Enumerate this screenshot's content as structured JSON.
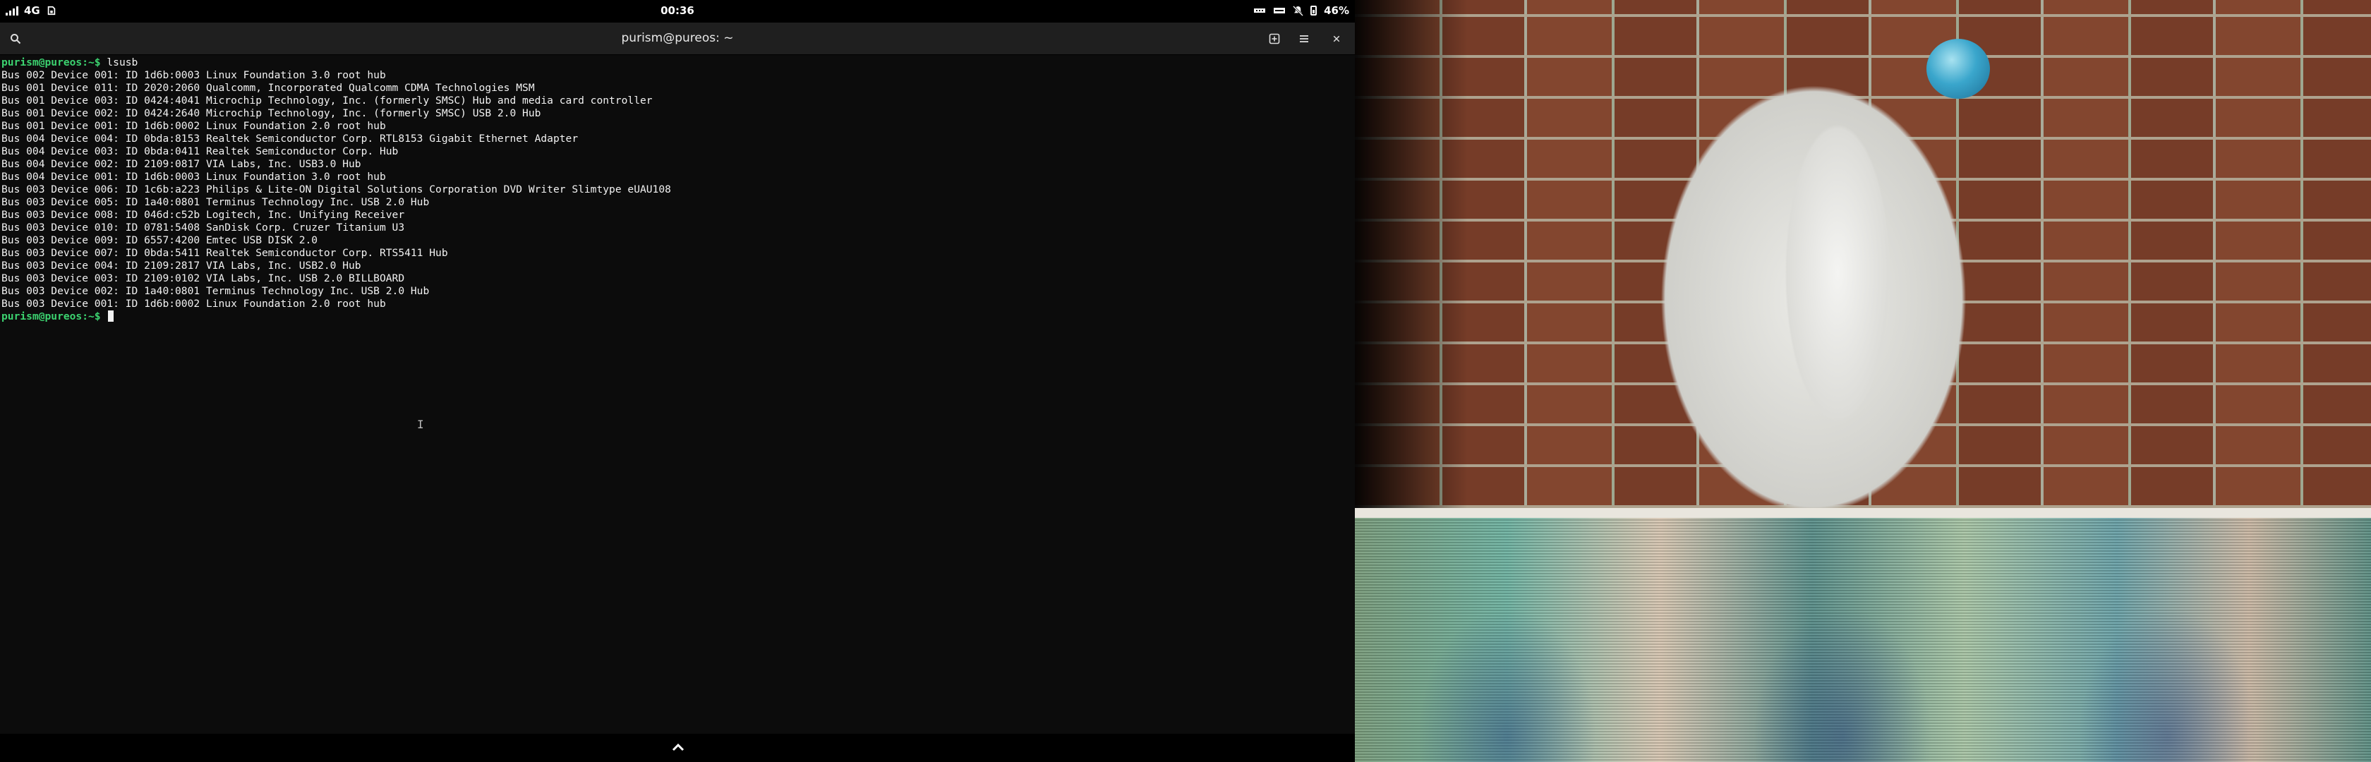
{
  "statusbar": {
    "network": "4G",
    "clock": "00:36",
    "battery": "46%"
  },
  "window": {
    "title": "purism@pureos: ~"
  },
  "terminal": {
    "prompt": "purism@pureos:~$",
    "command": " lsusb",
    "lines": [
      "Bus 002 Device 001: ID 1d6b:0003 Linux Foundation 3.0 root hub",
      "Bus 001 Device 011: ID 2020:2060 Qualcomm, Incorporated Qualcomm CDMA Technologies MSM",
      "Bus 001 Device 003: ID 0424:4041 Microchip Technology, Inc. (formerly SMSC) Hub and media card controller",
      "Bus 001 Device 002: ID 0424:2640 Microchip Technology, Inc. (formerly SMSC) USB 2.0 Hub",
      "Bus 001 Device 001: ID 1d6b:0002 Linux Foundation 2.0 root hub",
      "Bus 004 Device 004: ID 0bda:8153 Realtek Semiconductor Corp. RTL8153 Gigabit Ethernet Adapter",
      "Bus 004 Device 003: ID 0bda:0411 Realtek Semiconductor Corp. Hub",
      "Bus 004 Device 002: ID 2109:0817 VIA Labs, Inc. USB3.0 Hub",
      "Bus 004 Device 001: ID 1d6b:0003 Linux Foundation 3.0 root hub",
      "Bus 003 Device 006: ID 1c6b:a223 Philips & Lite-ON Digital Solutions Corporation DVD Writer Slimtype eUAU108",
      "Bus 003 Device 005: ID 1a40:0801 Terminus Technology Inc. USB 2.0 Hub",
      "Bus 003 Device 008: ID 046d:c52b Logitech, Inc. Unifying Receiver",
      "Bus 003 Device 010: ID 0781:5408 SanDisk Corp. Cruzer Titanium U3",
      "Bus 003 Device 009: ID 6557:4200 Emtec USB DISK 2.0",
      "Bus 003 Device 007: ID 0bda:5411 Realtek Semiconductor Corp. RTS5411 Hub",
      "Bus 003 Device 004: ID 2109:2817 VIA Labs, Inc. USB2.0 Hub",
      "Bus 003 Device 003: ID 2109:0102 VIA Labs, Inc. USB 2.0 BILLBOARD",
      "Bus 003 Device 002: ID 1a40:0801 Terminus Technology Inc. USB 2.0 Hub",
      "Bus 003 Device 001: ID 1d6b:0002 Linux Foundation 2.0 root hub"
    ],
    "final_prompt": "purism@pureos:~$"
  },
  "colors": {
    "prompt": "#3cd370",
    "terminal_bg": "#0c0c0c",
    "headerbar_bg": "#1f1f1f"
  },
  "icons": {
    "search": "search-icon",
    "new_tab": "new-tab-icon",
    "menu": "hamburger-menu-icon",
    "close": "close-icon",
    "expand": "chevron-up-icon"
  }
}
